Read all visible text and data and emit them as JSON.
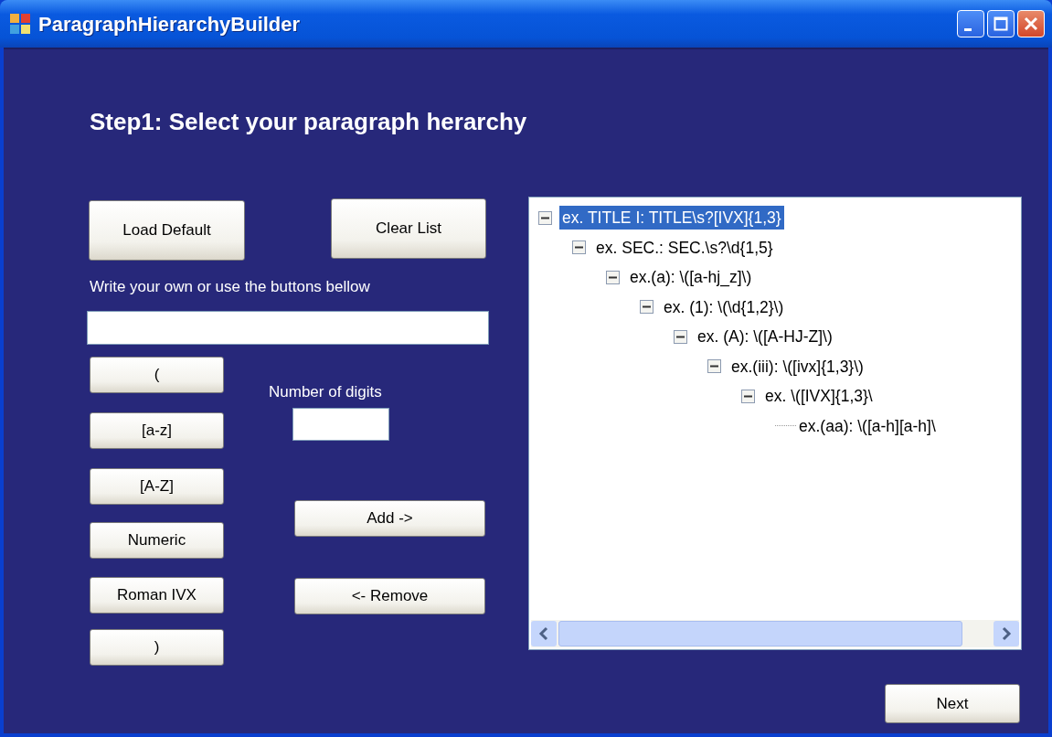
{
  "window": {
    "title": "ParagraphHierarchyBuilder"
  },
  "heading": "Step1: Select your paragraph herarchy",
  "top_buttons": [
    "Load Default",
    "Clear List"
  ],
  "instruction": "Write your own or use the buttons bellow",
  "token_buttons": [
    "(",
    "[a-z]",
    "[A-Z]",
    "Numeric",
    "Roman IVX",
    ")"
  ],
  "digits": {
    "label": "Number of digits"
  },
  "action_buttons": [
    "Add ->",
    "<- Remove"
  ],
  "tree": [
    {
      "label": "ex. TITLE I: TITLE\\s?[IVX]{1,3}",
      "selected": true,
      "expanded": true,
      "children": [
        {
          "label": "ex. SEC.: SEC.\\s?\\d{1,5}",
          "selected": false,
          "expanded": true,
          "children": [
            {
              "label": "ex.(a): \\([a-hj_z]\\)",
              "selected": false,
              "expanded": true,
              "children": [
                {
                  "label": "ex. (1): \\(\\d{1,2}\\)",
                  "selected": false,
                  "expanded": true,
                  "children": [
                    {
                      "label": "ex. (A): \\([A-HJ-Z]\\)",
                      "selected": false,
                      "expanded": true,
                      "children": [
                        {
                          "label": "ex.(iii): \\([ivx]{1,3}\\)",
                          "selected": false,
                          "expanded": true,
                          "children": [
                            {
                              "label": "ex. \\([IVX]{1,3}\\",
                              "selected": false,
                              "expanded": true,
                              "children": [
                                {
                                  "label": "ex.(aa): \\([a-h][a-h]\\",
                                  "selected": false
                                }
                              ]
                            }
                          ]
                        }
                      ]
                    }
                  ]
                }
              ]
            }
          ]
        }
      ]
    }
  ],
  "next_button": "Next"
}
